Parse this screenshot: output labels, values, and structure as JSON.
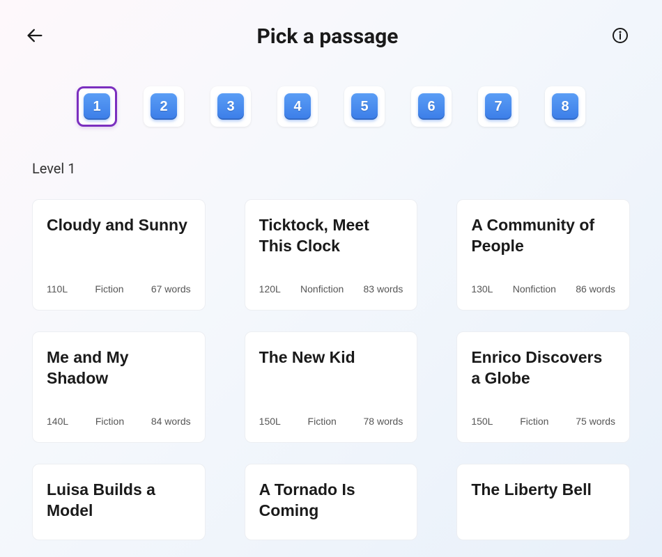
{
  "header": {
    "title": "Pick a passage"
  },
  "levels": {
    "items": [
      "1",
      "2",
      "3",
      "4",
      "5",
      "6",
      "7",
      "8"
    ],
    "selected_index": 0,
    "heading": "Level 1"
  },
  "passages": [
    {
      "title": "Cloudy and Sunny",
      "lexile": "110L",
      "genre": "Fiction",
      "words": "67 words"
    },
    {
      "title": "Ticktock, Meet This Clock",
      "lexile": "120L",
      "genre": "Nonfiction",
      "words": "83 words"
    },
    {
      "title": "A Community of People",
      "lexile": "130L",
      "genre": "Nonfiction",
      "words": "86 words"
    },
    {
      "title": "Me and My Shadow",
      "lexile": "140L",
      "genre": "Fiction",
      "words": "84 words"
    },
    {
      "title": "The New Kid",
      "lexile": "150L",
      "genre": "Fiction",
      "words": "78 words"
    },
    {
      "title": "Enrico Discovers a Globe",
      "lexile": "150L",
      "genre": "Fiction",
      "words": "75 words"
    },
    {
      "title": "Luisa Builds a Model",
      "lexile": "",
      "genre": "",
      "words": ""
    },
    {
      "title": "A Tornado Is Coming",
      "lexile": "",
      "genre": "",
      "words": ""
    },
    {
      "title": "The Liberty Bell",
      "lexile": "",
      "genre": "",
      "words": ""
    }
  ]
}
